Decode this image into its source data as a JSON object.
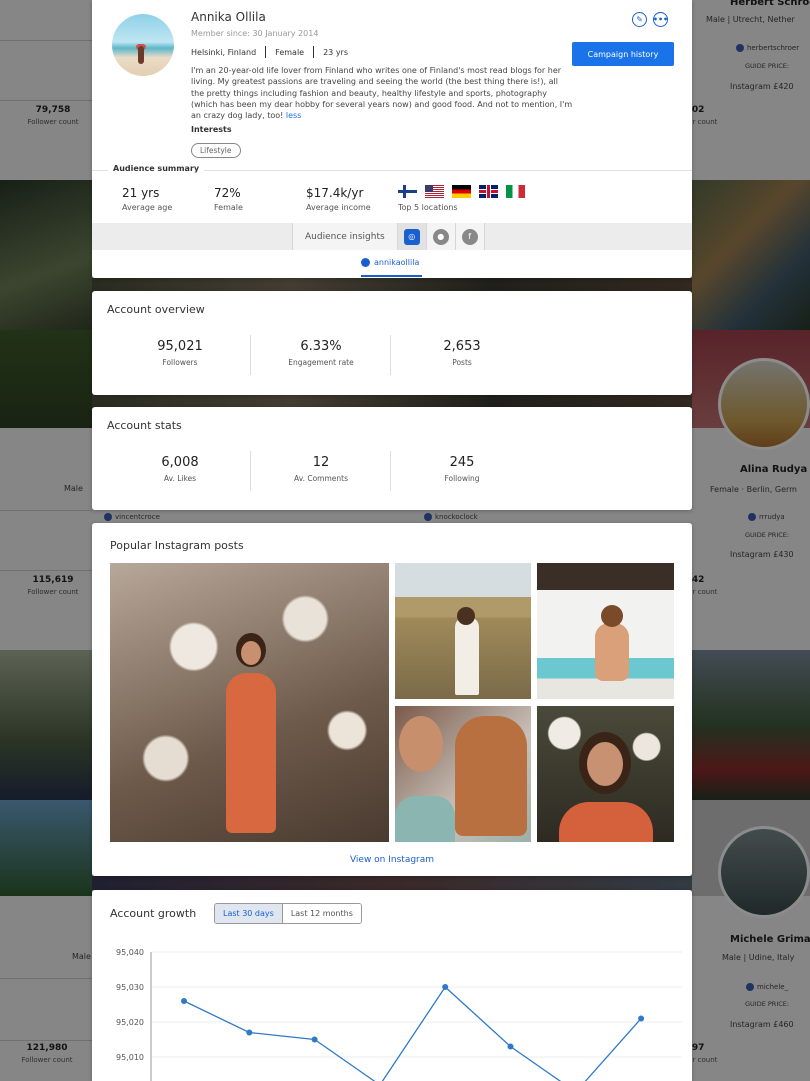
{
  "profile": {
    "name": "Annika Ollila",
    "member_since": "Member since: 30 January 2014",
    "location": "Helsinki, Finland",
    "gender": "Female",
    "age": "23 yrs",
    "bio": "I'm an 20-year-old life lover from Finland who writes one of Finland's most read blogs for her living. My greatest passions are traveling and seeing the world (the best thing there is!), all the pretty things including fashion and beauty, healthy lifestyle and sports, photography (which has been my dear hobby for several years now) and good food. And not to mention, I'm an crazy dog lady, too!",
    "bio_toggle": "less",
    "interests_label": "Interests",
    "interests": [
      "Lifestyle"
    ],
    "campaign_button": "Campaign history",
    "edit_icon": "edit-icon",
    "more_icon": "more-icon"
  },
  "audience": {
    "label": "Audience summary",
    "age": "21 yrs",
    "age_label": "Average age",
    "female": "72%",
    "female_label": "Female",
    "income": "$17.4k/yr",
    "income_label": "Average income",
    "locations_label": "Top 5 locations",
    "flags": [
      "Finland",
      "United States",
      "Germany",
      "United Kingdom",
      "Italy"
    ]
  },
  "insights": {
    "label": "Audience insights",
    "networks": [
      "instagram",
      "snapchat",
      "facebook"
    ],
    "active_network": "instagram",
    "handle": "annikaollila"
  },
  "overview": {
    "title": "Account overview",
    "metrics": [
      {
        "value": "95,021",
        "label": "Followers"
      },
      {
        "value": "6.33%",
        "label": "Engagement rate"
      },
      {
        "value": "2,653",
        "label": "Posts"
      }
    ]
  },
  "stats": {
    "title": "Account stats",
    "metrics": [
      {
        "value": "6,008",
        "label": "Av. Likes"
      },
      {
        "value": "12",
        "label": "Av. Comments"
      },
      {
        "value": "245",
        "label": "Following"
      }
    ]
  },
  "posts": {
    "title": "Popular Instagram posts",
    "link": "View on Instagram"
  },
  "growth": {
    "title": "Account growth",
    "tabs": [
      "Last 30 days",
      "Last 12 months"
    ],
    "active_tab": "Last 30 days"
  },
  "chart_data": {
    "type": "line",
    "yticks": [
      "95,040",
      "95,030",
      "95,020",
      "95,010"
    ],
    "ylim": [
      95000,
      95040
    ],
    "series": [
      {
        "values": [
          95026,
          95017,
          95015,
          95002,
          95030,
          95013,
          95000,
          95021
        ]
      }
    ],
    "color": "#2f7ac8"
  },
  "background": {
    "left_column": [
      {
        "followers": "79,758",
        "followers_label": "Follower count"
      },
      {
        "followers": "115,619",
        "followers_label": "Follower count"
      },
      {
        "followers": "121,980",
        "followers_label": "Follower count"
      }
    ],
    "right_column": [
      {
        "name": "Herbert Schroer",
        "gender": "Male",
        "location": "Utrecht, Nether",
        "handle": "herbertschroer",
        "price_label": "GUIDE PRICE:",
        "price": "Instagram  £420",
        "followers": "802",
        "followers_label": "r count"
      },
      {
        "name": "Alina Rudya",
        "gender": "Female",
        "location": "Berlin, Germ",
        "handle": "rrrudya",
        "price_label": "GUIDE PRICE:",
        "price": "Instagram  £430",
        "followers": "442",
        "followers_label": "r count"
      },
      {
        "name": "Michele Grimaz",
        "gender": "Male",
        "location": "Udine, Italy",
        "handle": "michele_",
        "price_label": "GUIDE PRICE:",
        "price": "Instagram  £460",
        "followers": "297",
        "followers_label": "r count"
      }
    ],
    "middle_handles": [
      "vincentcroce",
      "knockoclock"
    ],
    "male_labels": [
      "Male",
      "Male",
      "Male"
    ]
  }
}
